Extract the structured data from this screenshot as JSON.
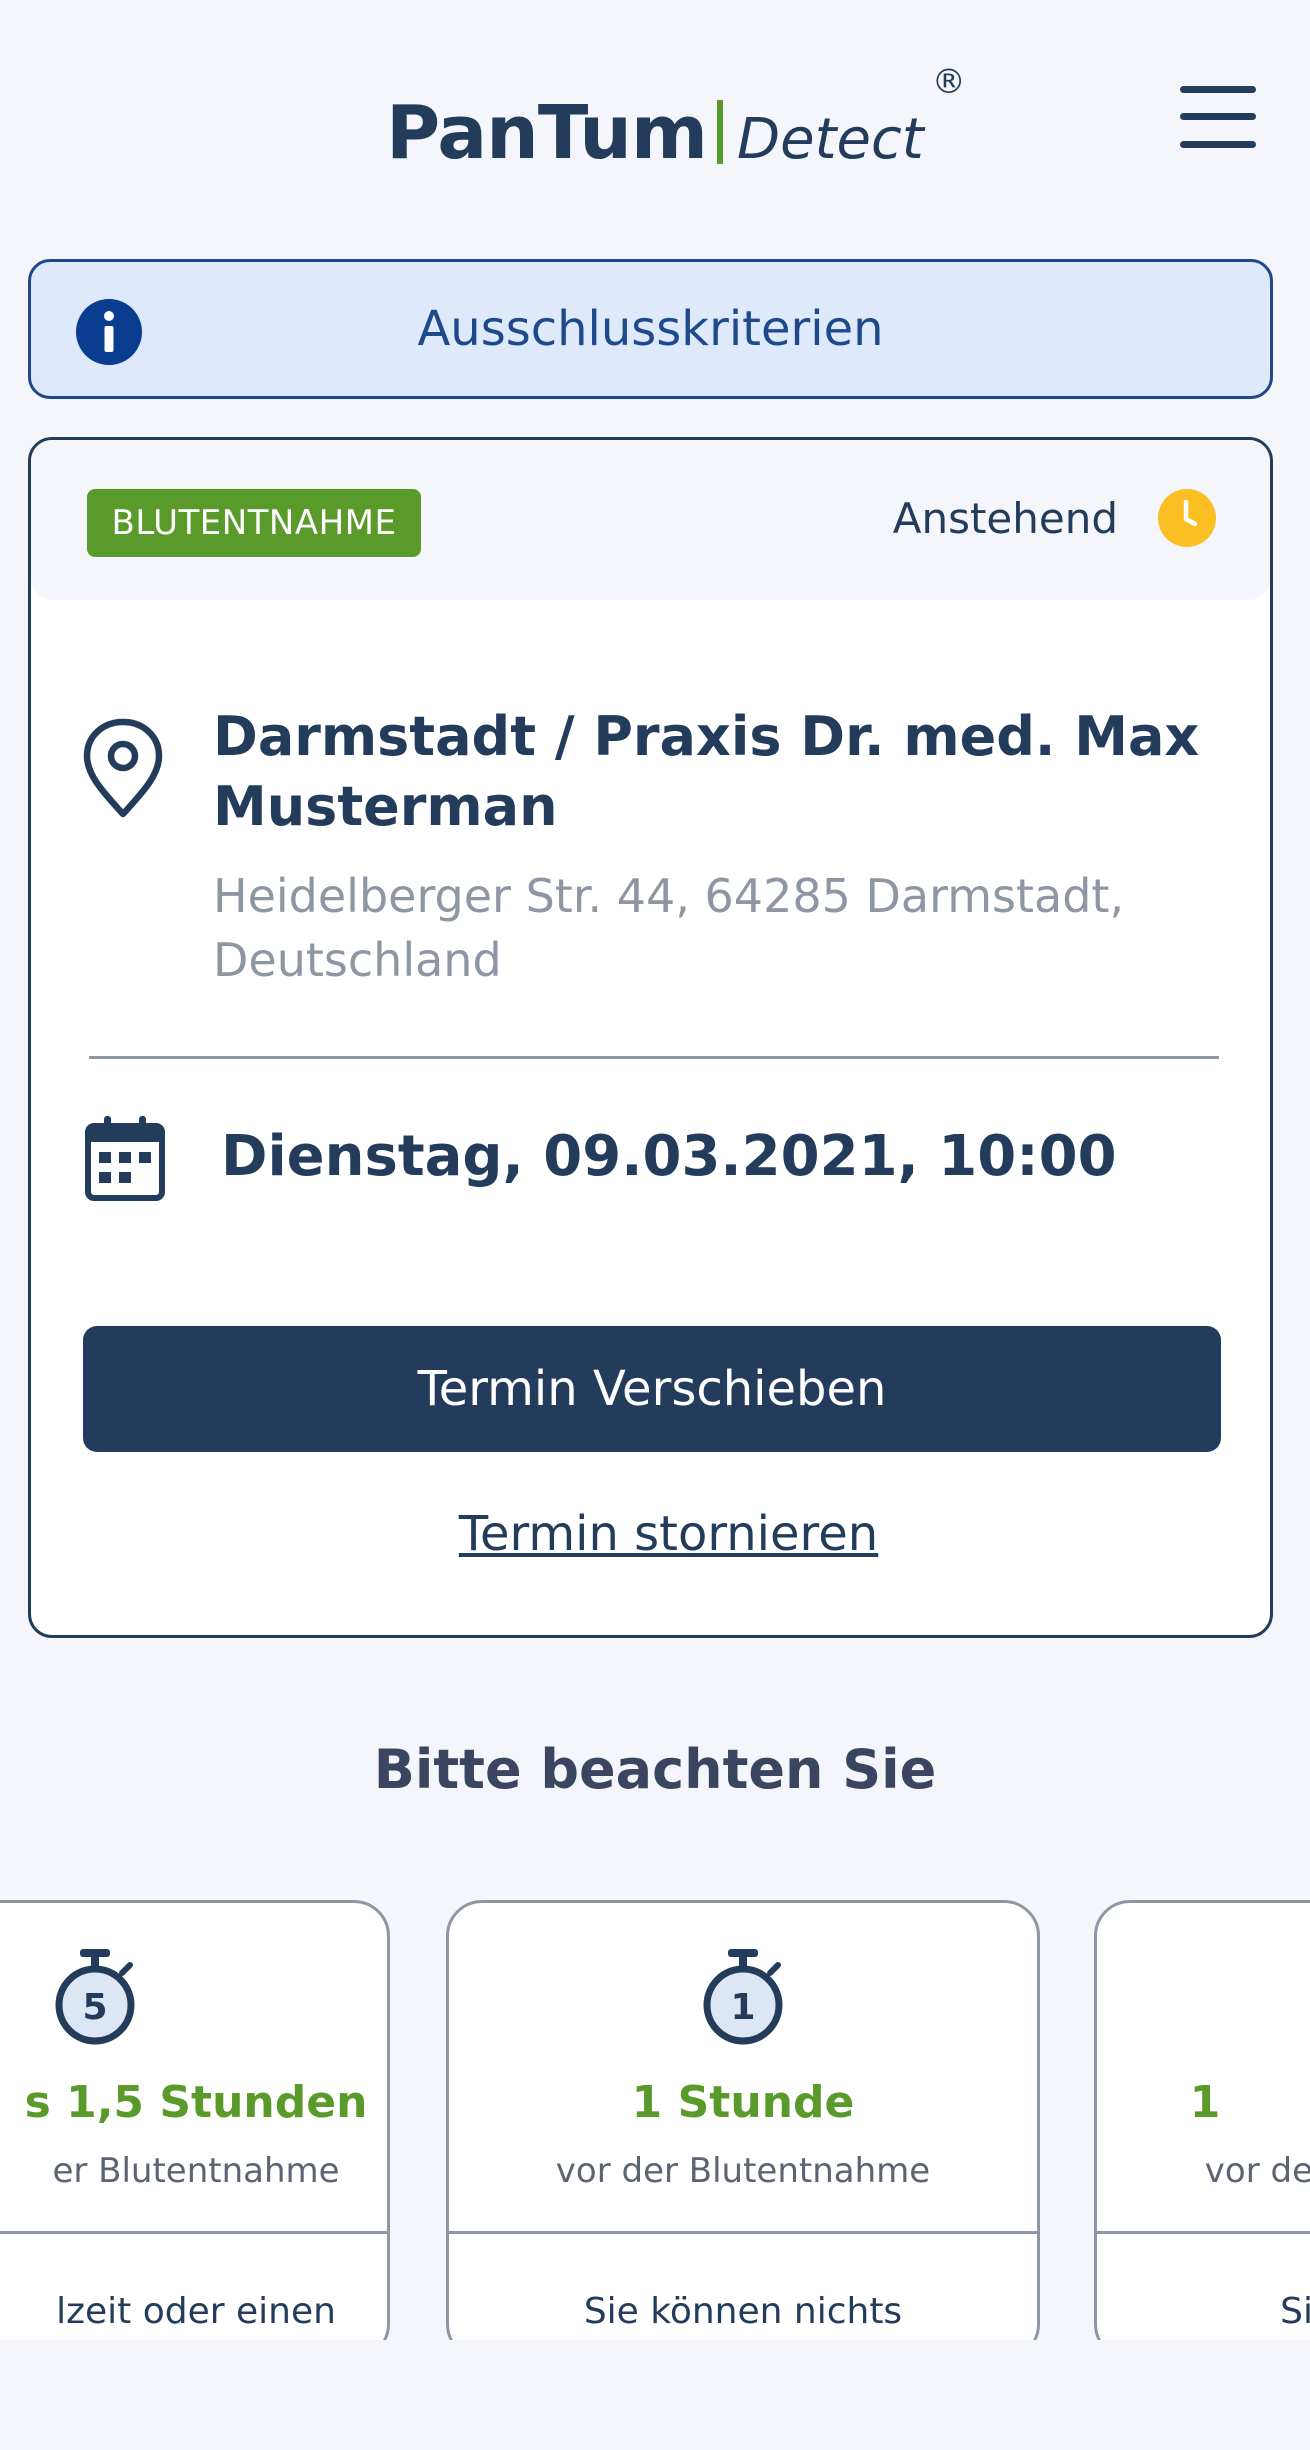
{
  "header": {
    "logo_main": "PanTum",
    "logo_sub": "Detect",
    "logo_reg": "®",
    "menu_icon": "hamburger-menu-icon"
  },
  "banner": {
    "label": "Ausschlusskriterien",
    "icon": "info-icon",
    "color": "#1e4a8c"
  },
  "appointment": {
    "tag": "BLUTENTNAHME",
    "status": "Anstehend",
    "status_icon": "clock-icon",
    "location_title": "Darmstadt / Praxis Dr. med. Max Musterman",
    "address": "Heidelberger Str. 44, 64285 Darmstadt, Deutschland",
    "datetime": "Dienstag, 09.03.2021, 10:00",
    "reschedule_label": "Termin Verschieben",
    "cancel_label": "Termin stornieren"
  },
  "notice": {
    "title": "Bitte beachten Sie",
    "tips": [
      {
        "icon": "stopwatch-5-icon",
        "icon_number": "5",
        "title": "s 1,5 Stunden",
        "subtitle": "er Blutentnahme",
        "body": "lzeit oder einen"
      },
      {
        "icon": "stopwatch-1-icon",
        "icon_number": "1",
        "title": "1 Stunde",
        "subtitle": "vor der Blutentnahme",
        "body": "Sie können nichts"
      },
      {
        "icon": "",
        "icon_number": "",
        "title": "1",
        "subtitle": "vor de",
        "body": "Si"
      }
    ]
  },
  "colors": {
    "navy": "#243c5c",
    "green": "#5a9a2b",
    "status_yellow": "#fbbf24",
    "banner_bg": "#deeafc"
  }
}
